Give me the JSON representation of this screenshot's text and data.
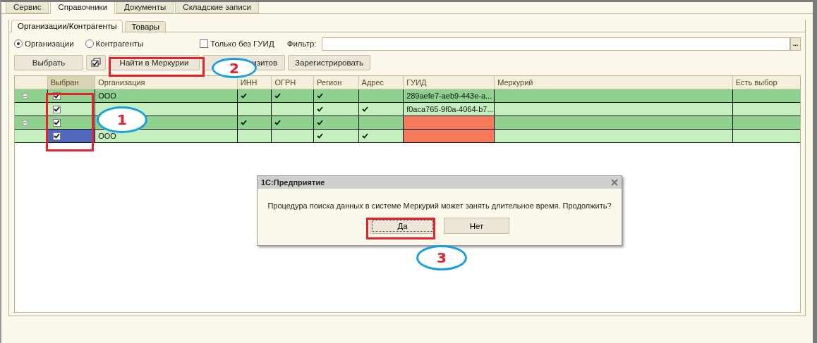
{
  "top_tabs": [
    {
      "label": "Сервис",
      "selected": false
    },
    {
      "label": "Справочники",
      "selected": true
    },
    {
      "label": "Документы",
      "selected": false
    },
    {
      "label": "Складские записи",
      "selected": false
    }
  ],
  "sub_tabs": [
    {
      "label": "Организации/Контрагенты",
      "selected": true
    },
    {
      "label": "Товары",
      "selected": false
    }
  ],
  "radios": [
    {
      "label": "Организации",
      "selected": true
    },
    {
      "label": "Контрагенты",
      "selected": false
    }
  ],
  "only_without_guid": {
    "label": "Только без ГУИД",
    "checked": false
  },
  "filter": {
    "label": "Фильтр:",
    "button": "..."
  },
  "buttons": [
    {
      "kind": "text",
      "label": "Выбрать"
    },
    {
      "kind": "icon"
    },
    {
      "kind": "text",
      "label": "Найти в Меркурии"
    },
    {
      "kind": "text",
      "label": "изитов"
    },
    {
      "kind": "text",
      "label": "Зарегистрировать"
    }
  ],
  "table": {
    "columns": [
      "Выбран",
      "Организация",
      "ИНН",
      "ОГРН",
      "Регион",
      "Адрес",
      "ГУИД",
      "Меркурий",
      "Есть выбор"
    ],
    "rows": [
      {
        "kind": "group",
        "expanded": true,
        "checked": true,
        "selected": false,
        "organization": "ООО",
        "inn": true,
        "ogrn": true,
        "region": true,
        "address": false,
        "guid": "289aefe7-aeb9-443e-a...",
        "guid_missing": false
      },
      {
        "kind": "item",
        "checked": true,
        "selected": false,
        "inn": false,
        "ogrn": false,
        "region": true,
        "address": true,
        "guid": "f0aca765-9f0a-4064-b7...",
        "guid_missing": false
      },
      {
        "kind": "group",
        "expanded": true,
        "checked": true,
        "selected": false,
        "inn": true,
        "ogrn": true,
        "region": true,
        "address": false,
        "guid_missing": true
      },
      {
        "kind": "item",
        "checked": true,
        "selected": true,
        "organization": "ООО",
        "inn": false,
        "ogrn": false,
        "region": true,
        "address": true,
        "guid_missing": true
      }
    ]
  },
  "dialog": {
    "title": "1С:Предприятие",
    "message": "Процедура поиска данных в системе Меркурий может занять длительное время. Продолжить?",
    "buttons": [
      {
        "label": "Да",
        "selected": true
      },
      {
        "label": "Нет",
        "selected": false
      }
    ]
  },
  "annotations": [
    {
      "kind": "frame"
    },
    {
      "kind": "frame"
    },
    {
      "kind": "frame"
    },
    {
      "kind": "marker",
      "label": "1"
    },
    {
      "kind": "marker",
      "label": "2"
    },
    {
      "kind": "marker",
      "label": "3"
    }
  ]
}
